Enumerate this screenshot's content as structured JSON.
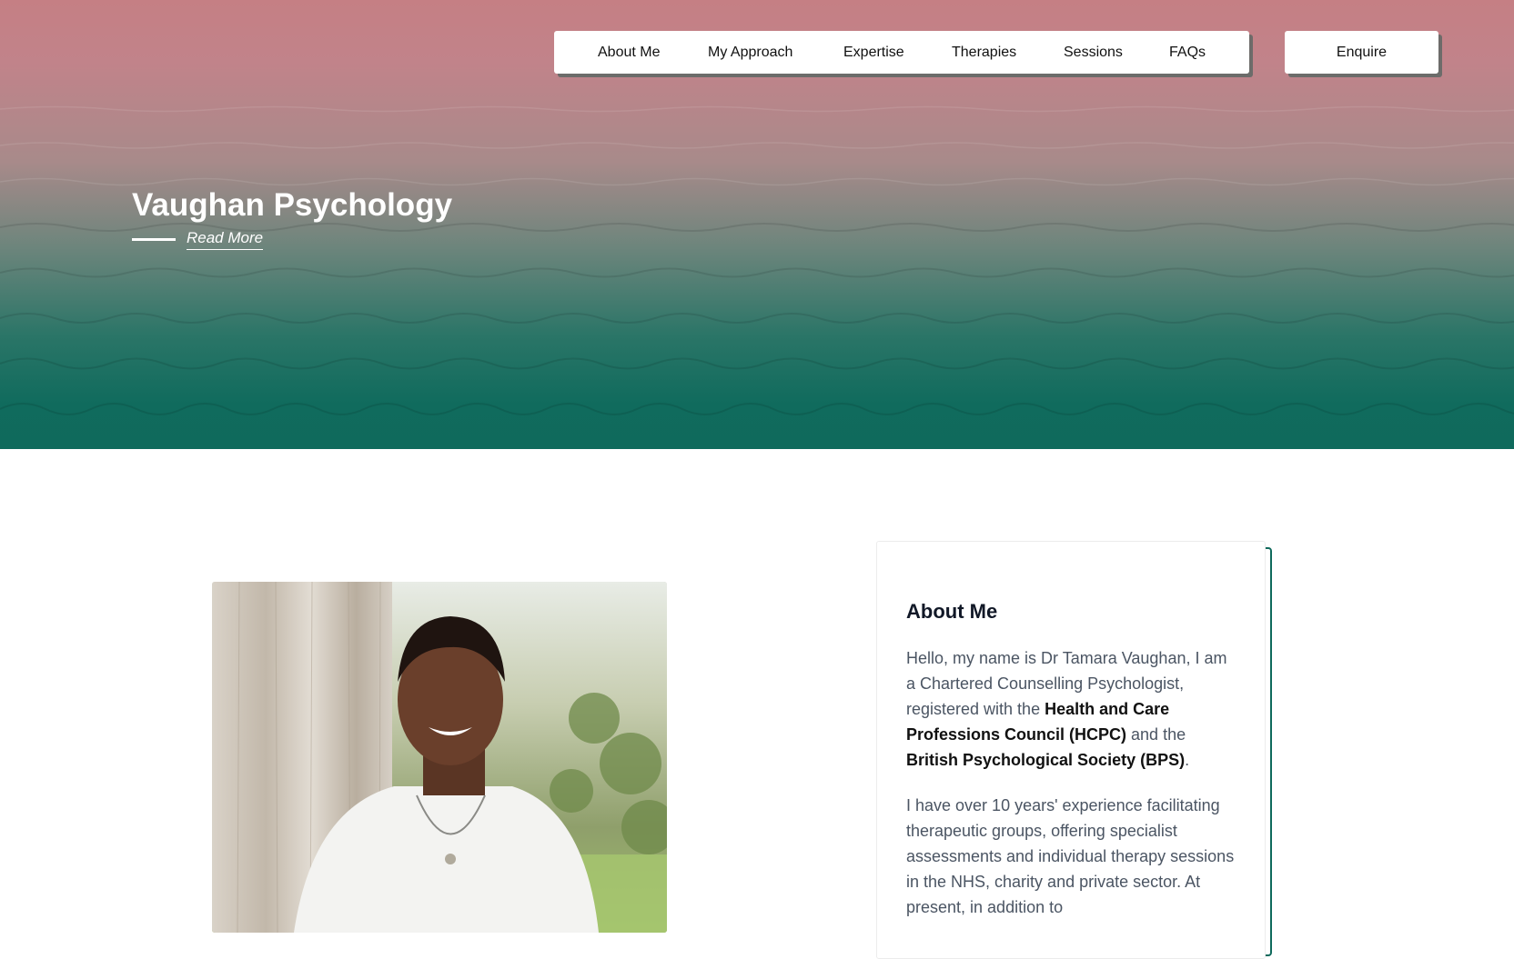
{
  "nav": {
    "items": [
      {
        "label": "About Me"
      },
      {
        "label": "My Approach"
      },
      {
        "label": "Expertise"
      },
      {
        "label": "Therapies"
      },
      {
        "label": "Sessions"
      },
      {
        "label": "FAQs"
      }
    ],
    "enquire_label": "Enquire"
  },
  "hero": {
    "title": "Vaughan Psychology",
    "read_more": "Read More"
  },
  "about": {
    "title": "About Me",
    "p1_start": "Hello, my name is Dr Tamara Vaughan, I am a Chartered Counselling Psychologist, registered with the ",
    "p1_bold1": "Health and Care Professions Council (HCPC)",
    "p1_mid": " and the ",
    "p1_bold2": "British Psychological Society (BPS)",
    "p1_end": ".",
    "p2": "I have over 10 years' experience facilitating therapeutic groups, offering specialist assessments and individual therapy sessions in the NHS, charity and private sector. At present, in addition to"
  },
  "colors": {
    "hero_top": "#c57f84",
    "hero_bottom": "#0f6a5c",
    "accent": "#0f6a5c",
    "heading": "#111827",
    "body_text": "#4b5563"
  }
}
